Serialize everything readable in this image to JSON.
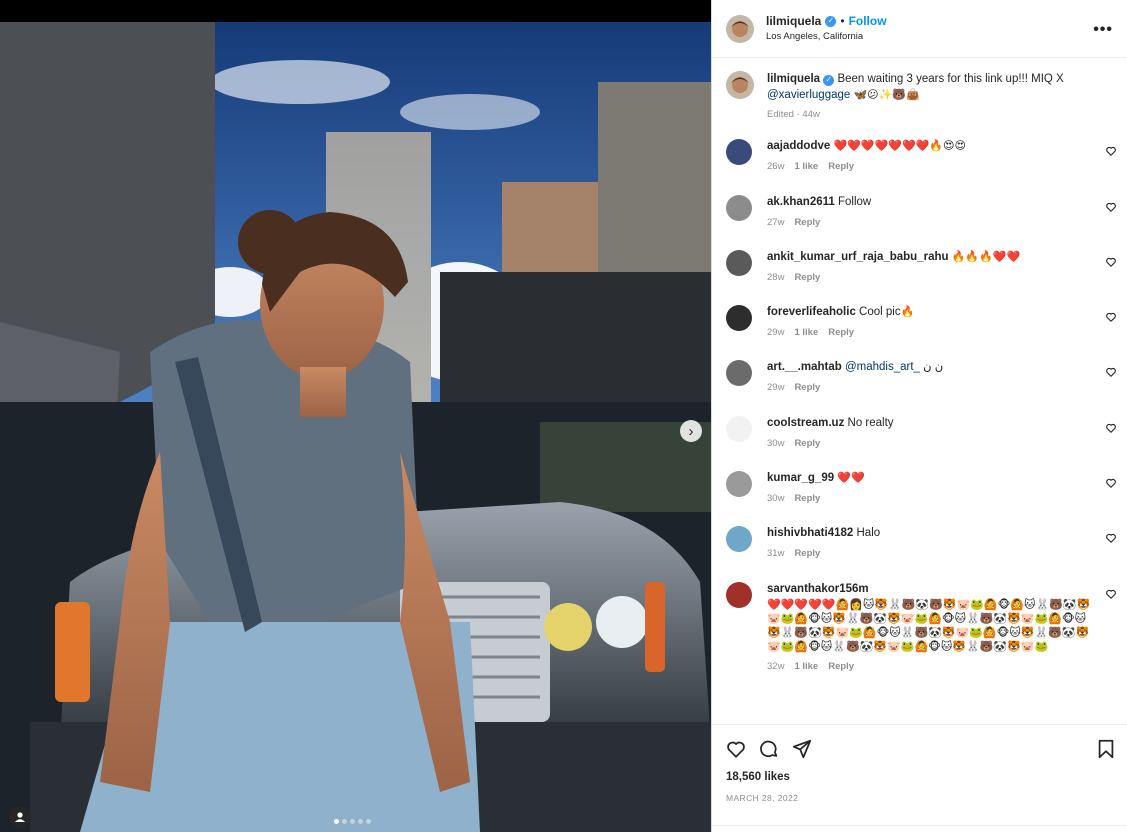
{
  "post": {
    "username": "lilmiquela",
    "follow_label": "Follow",
    "separator": "•",
    "location": "Los Angeles, California",
    "more_label": "•••",
    "caption_text": "Been waiting 3 years for this link up!!! MIQ X",
    "caption_mention": "@xavierluggage",
    "caption_emoji": "🦋😕✨🐻👜",
    "caption_meta": "Edited · 44w",
    "likes": "18,560 likes",
    "date": "MARCH 28, 2022",
    "carousel_total": 5,
    "carousel_index": 1
  },
  "comments": [
    {
      "user": "aajaddodve",
      "text": "",
      "emoji": "❤️❤️❤️❤️❤️❤️❤️🔥😍😍",
      "time": "26w",
      "likes": "1 like",
      "reply": "Reply"
    },
    {
      "user": "ak.khan2611",
      "text": "Follow",
      "emoji": "",
      "time": "27w",
      "likes": "",
      "reply": "Reply"
    },
    {
      "user": "ankit_kumar_urf_raja_babu_rahu",
      "text": "",
      "emoji": "🔥🔥🔥❤️❤️",
      "time": "28w",
      "likes": "",
      "reply": "Reply"
    },
    {
      "user": "foreverlifeaholic",
      "text": "Cool pic",
      "emoji": "🔥",
      "time": "29w",
      "likes": "1 like",
      "reply": "Reply"
    },
    {
      "user": "art.__.mahtab",
      "text": "ن ن",
      "mention": "@mahdis_art_",
      "emoji": "",
      "time": "29w",
      "likes": "",
      "reply": "Reply"
    },
    {
      "user": "coolstream.uz",
      "text": "No realty",
      "emoji": "",
      "time": "30w",
      "likes": "",
      "reply": "Reply"
    },
    {
      "user": "kumar_g_99",
      "text": "",
      "emoji": "❤️❤️",
      "time": "30w",
      "likes": "",
      "reply": "Reply"
    },
    {
      "user": "hishivbhati4182",
      "text": "Halo",
      "emoji": "",
      "time": "31w",
      "likes": "",
      "reply": "Reply"
    },
    {
      "user": "sarvanthakor156m",
      "text": "",
      "emoji": "❤️❤️❤️❤️❤️🙆👩🐱🐯🐰🐻🐼🐻🐯🐷🐸🙆🐵🙆🐱🐰🐻🐼🐯🐷🐸🙆🐵🐱🐯🐰🐻🐼🐯🐷🐸🙆🐵🐱🐰🐻🐼🐯🐷🐸🙆🐵🐱🐯🐰🐻🐼🐯🐷🐸🙆🐵🐱🐰🐻🐼🐯🐷🐸🙆🐵🐱🐯🐰🐻🐼🐯🐷🐸🙆🐵🐱🐰🐻🐼🐯🐷🐸🙆🐵🐱🐯🐰🐻🐼🐯🐷🐸",
      "time": "32w",
      "likes": "1 like",
      "reply": "Reply"
    }
  ],
  "colors": {
    "accent": "#0095f6",
    "verified": "#3897f0",
    "heart": "#e0245e",
    "muted": "#8e8e8e"
  },
  "icons": [
    "verified-badge-icon",
    "more-options-icon",
    "heart-icon",
    "comment-icon",
    "share-icon",
    "bookmark-icon",
    "chevron-right-icon",
    "user-tag-icon"
  ]
}
